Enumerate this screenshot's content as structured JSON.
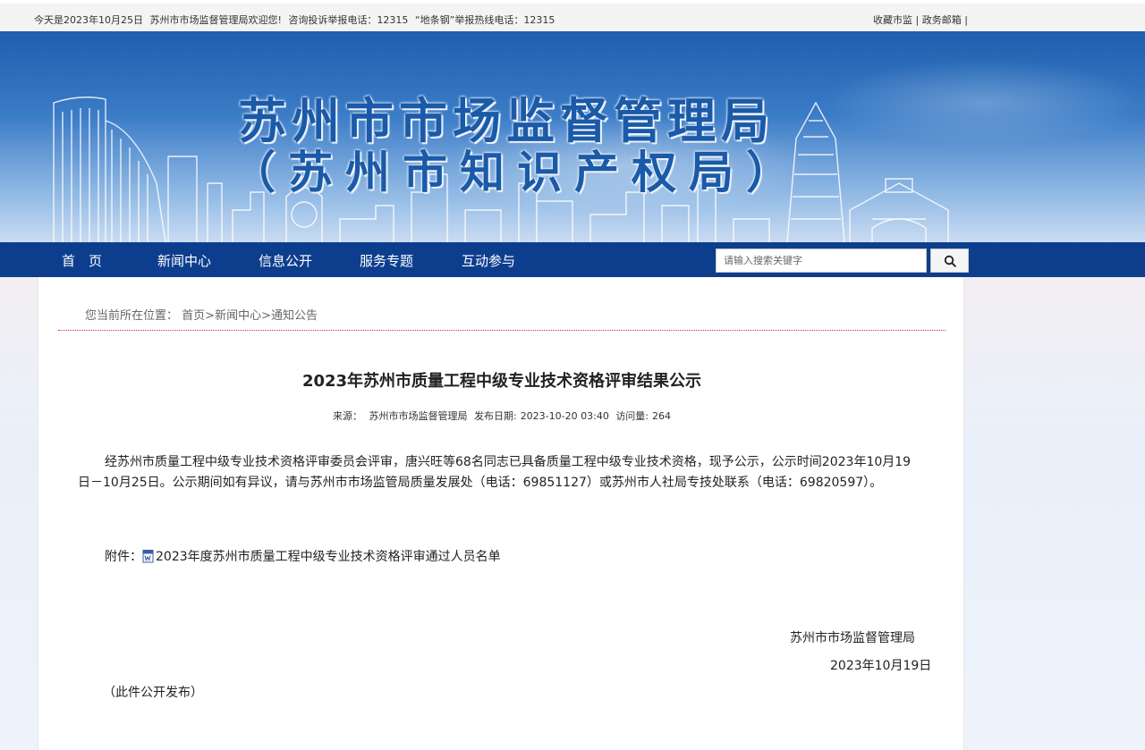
{
  "topbar": {
    "date_text": "今天是2023年10月25日",
    "welcome": "苏州市市场监督管理局欢迎您!",
    "hotline": "咨询投诉举报电话：12315",
    "report_line": "“地条钢”举报热线电话：12315",
    "favorite": "收藏市监",
    "separator": " | ",
    "mail": "政务邮箱",
    "trailing": " |"
  },
  "banner": {
    "title_line1": "苏州市市场监督管理局",
    "title_line2": "（苏州市知识产权局）"
  },
  "nav": {
    "items": [
      "首　页",
      "新闻中心",
      "信息公开",
      "服务专题",
      "互动参与"
    ],
    "search_placeholder": "请输入搜索关键字",
    "search_icon": "search-icon"
  },
  "breadcrumb": {
    "prefix": "您当前所在位置：",
    "home": "首页",
    "sep": ">",
    "level1": "新闻中心",
    "level2": "通知公告"
  },
  "article": {
    "title": "2023年苏州市质量工程中级专业技术资格评审结果公示",
    "source_label": "来源：",
    "source": "苏州市市场监督管理局",
    "date_label": "发布日期:",
    "date": "2023-10-20 03:40",
    "views_label": "访问量:",
    "views": "264",
    "body": "经苏州市质量工程中级专业技术资格评审委员会评审，唐兴旺等68名同志已具备质量工程中级专业技术资格，现予公示，公示时间2023年10月19日－10月25日。公示期间如有异议，请与苏州市市场监管局质量发展处（电话：69851127）或苏州市人社局专技处联系（电话：69820597）。",
    "attachment_label": "附件：",
    "attachment_icon": "word-doc-icon",
    "attachment_name": "2023年度苏州市质量工程中级专业技术资格评审通过人员名单",
    "sign_org": "苏州市市场监督管理局",
    "sign_date": "2023年10月19日",
    "note": "（此件公开发布）"
  },
  "colors": {
    "nav_bg": "#0d3e8e",
    "title_blue": "#1a5aa8",
    "divider_red": "#cc3333"
  }
}
